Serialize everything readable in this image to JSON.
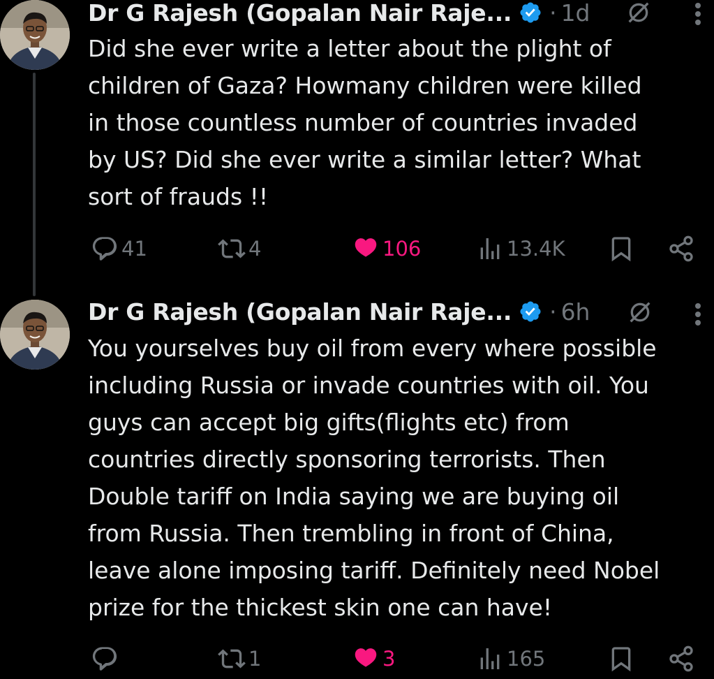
{
  "posts": [
    {
      "author": "Dr G Rajesh (Gopalan Nair Raje...",
      "separator": "·",
      "time": "1d",
      "text": "Did she ever write a letter about the plight of\nchildren of Gaza? Howmany children were killed\nin those countless number of countries invaded\nby US? Did she ever write a similar letter? What\nsort of frauds !!",
      "replies": "41",
      "reposts": "4",
      "likes": "106",
      "views": "13.4K"
    },
    {
      "author": "Dr G Rajesh (Gopalan Nair Raje...",
      "separator": "·",
      "time": "6h",
      "text": "You yourselves buy oil from every where possible\nincluding Russia or invade countries with oil. You\nguys can accept big gifts(flights etc) from\ncountries directly sponsoring terrorists. Then\nDouble tariff on India saying we are buying oil\nfrom Russia. Then trembling in front of China,\nleave alone imposing tariff. Definitely need Nobel\nprize for the thickest skin one can have!",
      "replies": "",
      "reposts": "1",
      "likes": "3",
      "views": "165"
    }
  ],
  "colors": {
    "background": "#000000",
    "text": "#e7e9ea",
    "muted": "#71767b",
    "like": "#f91880",
    "verified": "#1d9bf0",
    "thread_line": "#333639"
  }
}
